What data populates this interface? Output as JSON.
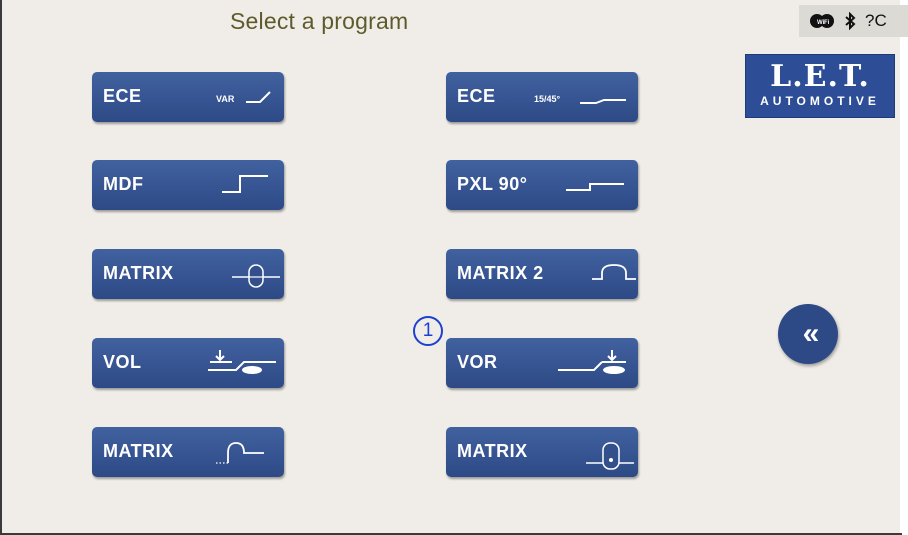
{
  "header": {
    "title": "Select a program"
  },
  "status_bar": {
    "wifi_icon": "wifi-icon",
    "bluetooth_icon": "bluetooth-icon",
    "text": "?C"
  },
  "logo": {
    "line1": "L.E.T.",
    "line2": "AUTOMOTIVE"
  },
  "colors": {
    "button": "#2d4a86",
    "background": "#f0ede8",
    "title": "#5e5a2c",
    "marker": "#1e3fd0"
  },
  "programs": {
    "left": [
      {
        "label": "ECE",
        "symbol": "ece-var-icon",
        "symbol_text": "VAR"
      },
      {
        "label": "MDF",
        "symbol": "mdf-step-icon"
      },
      {
        "label": "MATRIX",
        "symbol": "matrix-oval-icon"
      },
      {
        "label": "VOL",
        "symbol": "vol-icon"
      },
      {
        "label": "MATRIX",
        "symbol": "matrix-dotted-curve-icon"
      }
    ],
    "right": [
      {
        "label": "ECE",
        "symbol": "ece-15-45-icon",
        "symbol_text": "15/45°"
      },
      {
        "label": "PXL 90°",
        "symbol": "pxl-step-icon"
      },
      {
        "label": "MATRIX 2",
        "symbol": "matrix2-curve-icon"
      },
      {
        "label": "VOR",
        "symbol": "vor-icon"
      },
      {
        "label": "MATRIX",
        "symbol": "matrix-dot-icon"
      }
    ]
  },
  "marker": {
    "label": "1"
  },
  "back_button": {
    "label": "«",
    "icon": "double-chevron-left-icon"
  }
}
